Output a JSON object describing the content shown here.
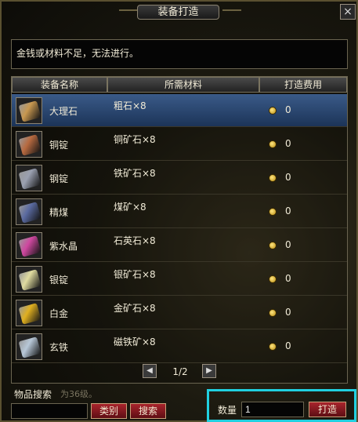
{
  "window": {
    "title": "装备打造",
    "close_glyph": "×"
  },
  "message": "金钱或材料不足，无法进行。",
  "columns": {
    "name": "装备名称",
    "materials": "所需材料",
    "cost": "打造费用"
  },
  "items": [
    {
      "name": "大理石",
      "materials": "粗石×8",
      "cost": "0",
      "icon": "marble-icon",
      "color": "#c89850"
    },
    {
      "name": "铜锭",
      "materials": "铜矿石×8",
      "cost": "0",
      "icon": "copper-ingot-icon",
      "color": "#b86a40"
    },
    {
      "name": "钢锭",
      "materials": "铁矿石×8",
      "cost": "0",
      "icon": "steel-ingot-icon",
      "color": "#9aa0b0"
    },
    {
      "name": "精煤",
      "materials": "煤矿×8",
      "cost": "0",
      "icon": "coal-icon",
      "color": "#5a6aa0"
    },
    {
      "name": "紫水晶",
      "materials": "石英石×8",
      "cost": "0",
      "icon": "amethyst-icon",
      "color": "#d048a0"
    },
    {
      "name": "银锭",
      "materials": "银矿石×8",
      "cost": "0",
      "icon": "silver-ingot-icon",
      "color": "#e0dca0"
    },
    {
      "name": "白金",
      "materials": "金矿石×8",
      "cost": "0",
      "icon": "platinum-icon",
      "color": "#e0b020"
    },
    {
      "name": "玄铁",
      "materials": "磁铁矿×8",
      "cost": "0",
      "icon": "black-iron-icon",
      "color": "#b8c8d8"
    }
  ],
  "pager": {
    "prev": "◀",
    "next": "▶",
    "text": "1/2"
  },
  "search": {
    "label": "物品搜索",
    "hint": "为36级。",
    "category_button": "类别",
    "search_button": "搜索",
    "value": ""
  },
  "craft": {
    "quantity_label": "数量",
    "quantity_value": "1",
    "craft_button": "打造"
  },
  "colors": {
    "selected_row": "#2a4a78",
    "highlight": "#20d0e0",
    "button_red": "#8a1820"
  }
}
